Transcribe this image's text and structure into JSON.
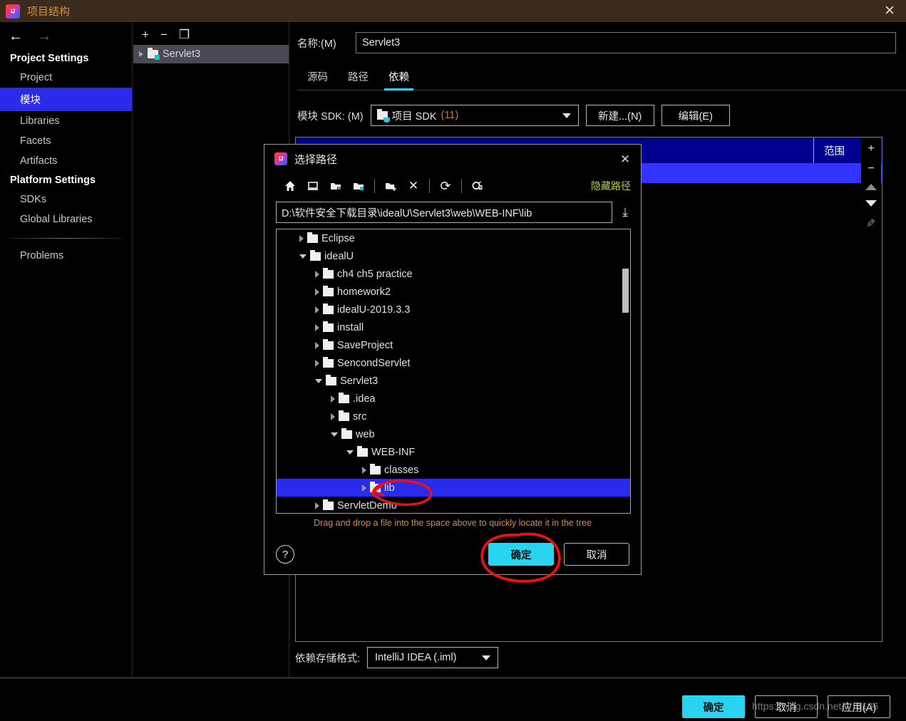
{
  "window": {
    "title": "项目结构",
    "close_label": "✕",
    "logo_text": "IJ"
  },
  "sidebar": {
    "nav_back": "←",
    "nav_forward": "→",
    "groups": [
      {
        "header": "Project Settings",
        "items": [
          "Project",
          "模块",
          "Libraries",
          "Facets",
          "Artifacts"
        ]
      },
      {
        "header": "Platform Settings",
        "items": [
          "SDKs",
          "Global Libraries"
        ]
      }
    ],
    "selected": "模块",
    "problems_label": "Problems",
    "help_label": "?"
  },
  "module_panel": {
    "toolbar": {
      "add": "+",
      "remove": "−",
      "copy": "❐"
    },
    "module_name": "Servlet3"
  },
  "main": {
    "name_label": "名称:(M)",
    "name_value": "Servlet3",
    "tabs": [
      {
        "label": "源码",
        "active": false
      },
      {
        "label": "路径",
        "active": false
      },
      {
        "label": "依赖",
        "active": true
      }
    ],
    "sdk_label": "模块 SDK: (M)",
    "sdk_value": "项目 SDK",
    "sdk_version": "(11)",
    "new_button": "新建...(N)",
    "edit_button": "编辑(E)",
    "table": {
      "column_scope": "范围"
    },
    "side_actions": {
      "add": "+",
      "remove": "−",
      "move_up": "▲",
      "move_down": "▼",
      "edit": "✎"
    },
    "storage_label": "依赖存储格式:",
    "storage_value": "IntelliJ IDEA (.iml)"
  },
  "bottom": {
    "ok": "确定",
    "cancel": "取消",
    "apply": "应用(A)",
    "watermark": "https://blog.csdn.net/w_1106"
  },
  "dialog": {
    "title": "选择路径",
    "close_label": "✕",
    "toolbar": {
      "home": "home-icon",
      "desktop": "desktop-icon",
      "project": "project-folder-icon",
      "module": "module-folder-icon",
      "new_folder": "new-folder-icon",
      "delete": "✕",
      "refresh": "⟳",
      "show_hidden": "show-hidden-icon"
    },
    "hide_path_label": "隐藏路径",
    "path_value": "D:\\软件安全下载目录\\idealU\\Servlet3\\web\\WEB-INF\\lib",
    "download_icon": "⤓",
    "tree": [
      {
        "name": "Eclipse",
        "indent": 1,
        "state": "collapsed",
        "selected": false
      },
      {
        "name": "idealU",
        "indent": 1,
        "state": "expanded",
        "selected": false
      },
      {
        "name": "ch4 ch5 practice",
        "indent": 2,
        "state": "collapsed",
        "selected": false
      },
      {
        "name": "homework2",
        "indent": 2,
        "state": "collapsed",
        "selected": false
      },
      {
        "name": "idealU-2019.3.3",
        "indent": 2,
        "state": "collapsed",
        "selected": false
      },
      {
        "name": "install",
        "indent": 2,
        "state": "collapsed",
        "selected": false
      },
      {
        "name": "SaveProject",
        "indent": 2,
        "state": "collapsed",
        "selected": false
      },
      {
        "name": "SencondServlet",
        "indent": 2,
        "state": "collapsed",
        "selected": false
      },
      {
        "name": "Servlet3",
        "indent": 2,
        "state": "expanded",
        "selected": false
      },
      {
        "name": ".idea",
        "indent": 3,
        "state": "collapsed",
        "selected": false
      },
      {
        "name": "src",
        "indent": 3,
        "state": "collapsed",
        "selected": false
      },
      {
        "name": "web",
        "indent": 3,
        "state": "expanded",
        "selected": false
      },
      {
        "name": "WEB-INF",
        "indent": 4,
        "state": "expanded",
        "selected": false
      },
      {
        "name": "classes",
        "indent": 5,
        "state": "collapsed",
        "selected": false
      },
      {
        "name": "lib",
        "indent": 5,
        "state": "collapsed",
        "selected": true
      },
      {
        "name": "ServletDemo",
        "indent": 2,
        "state": "collapsed",
        "selected": false
      }
    ],
    "hint": "Drag and drop a file into the space above to quickly locate it in the tree",
    "help_label": "?",
    "ok": "确定",
    "cancel": "取消"
  },
  "colors": {
    "accent_cyan": "#29d4f0",
    "selection_blue": "#2b2bec",
    "title_orange": "#d98e3a",
    "link_green": "#b9d34b",
    "annotation_red": "#ee1111"
  }
}
